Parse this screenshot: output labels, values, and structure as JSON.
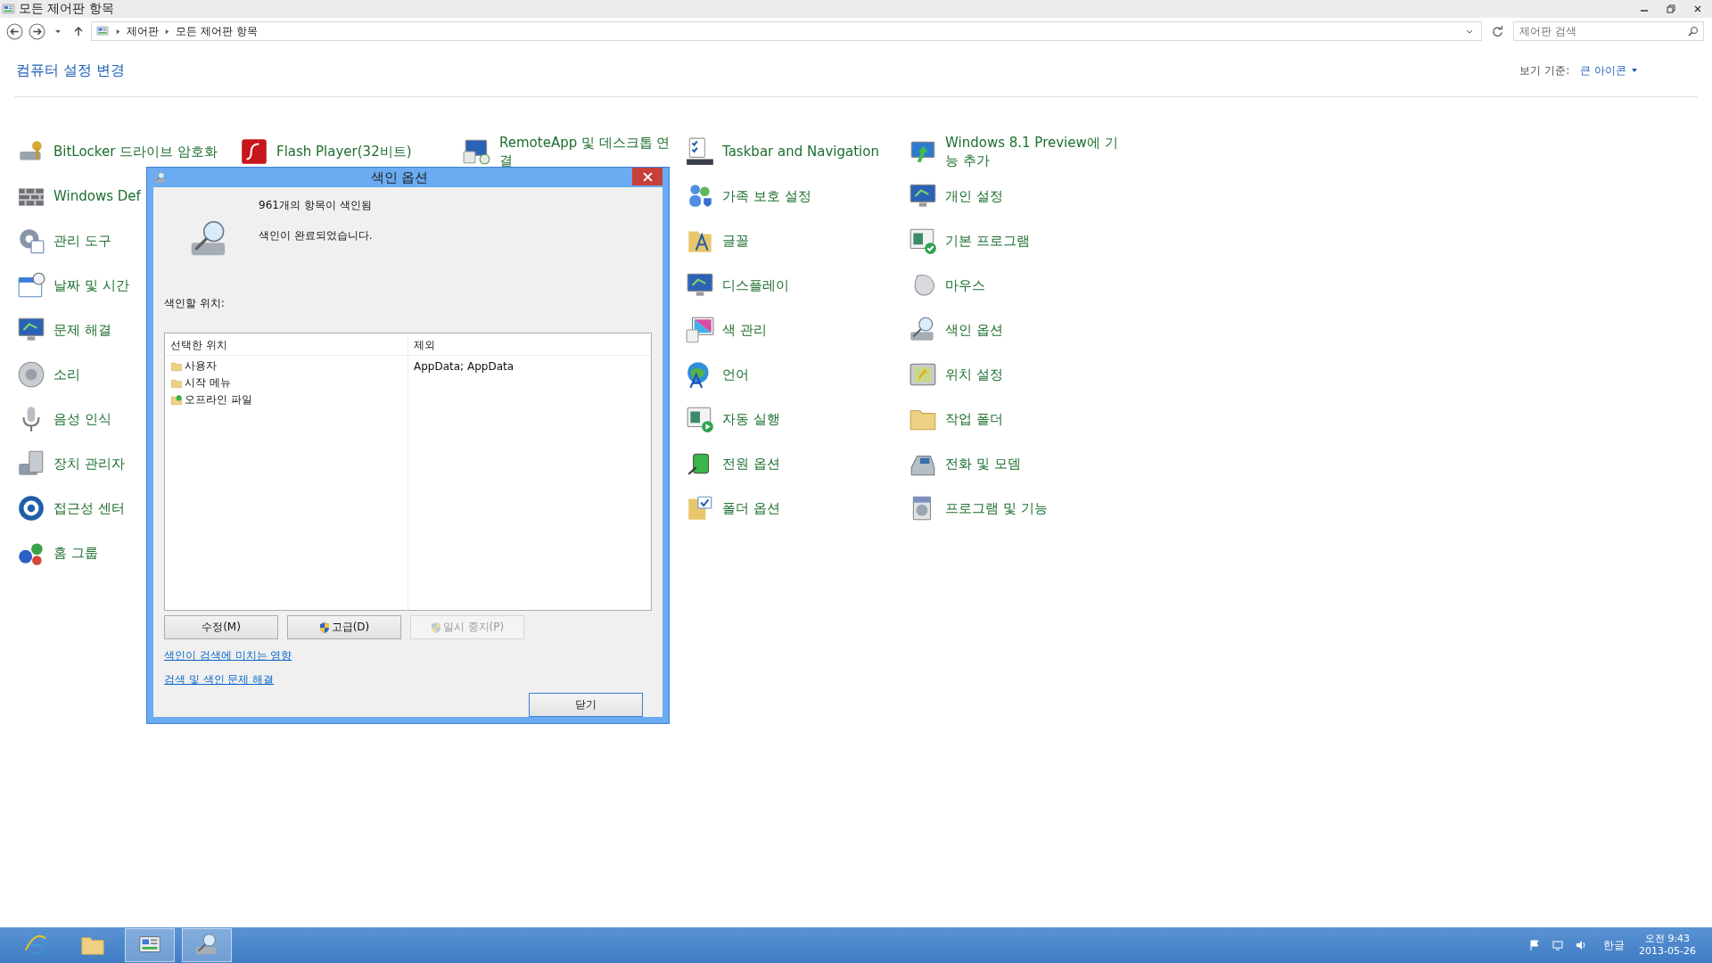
{
  "window": {
    "title": "모든 제어판 항목"
  },
  "address_bar": {
    "breadcrumbs": [
      "제어판",
      "모든 제어판 항목"
    ]
  },
  "search": {
    "placeholder": "제어판 검색"
  },
  "header": {
    "title": "컴퓨터 설정 변경",
    "view_label": "보기 기준:",
    "view_value": "큰 아이콘"
  },
  "columns": [
    {
      "items": [
        "BitLocker 드라이브 암호화",
        "Windows Def",
        "관리 도구",
        "날짜 및 시간",
        "문제 해결",
        "소리",
        "음성 인식",
        "장치 관리자",
        "접근성 센터",
        "홈 그룹"
      ]
    },
    {
      "items": [
        "Flash Player(32비트)"
      ]
    },
    {
      "items": [
        "RemoteApp 및 데스크톱 연결"
      ]
    },
    {
      "items": [
        "Taskbar and Navigation",
        "가족 보호 설정",
        "글꼴",
        "디스플레이",
        "색 관리",
        "언어",
        "자동 실행",
        "전원 옵션",
        "폴더 옵션"
      ]
    },
    {
      "items": [
        "Windows 8.1 Preview에 기능 추가",
        "개인 설정",
        "기본 프로그램",
        "마우스",
        "색인 옵션",
        "위치 설정",
        "작업 폴더",
        "전화 및 모뎀",
        "프로그램 및 기능"
      ]
    }
  ],
  "dialog": {
    "title": "색인 옵션",
    "status_count": "961개의 항목이 색인됨",
    "status_message": "색인이 완료되었습니다.",
    "locations_label": "색인할 위치:",
    "table": {
      "columns": [
        "선택한 위치",
        "제외"
      ],
      "rows": [
        {
          "location": "사용자",
          "exclude": "AppData; AppData",
          "kind": "folder"
        },
        {
          "location": "시작 메뉴",
          "kind": "folder"
        },
        {
          "location": "오프라인 파일",
          "kind": "sync"
        }
      ]
    },
    "buttons": [
      {
        "label": "수정(M)",
        "shield": false,
        "disabled": false
      },
      {
        "label": "고급(D)",
        "shield": true,
        "disabled": false
      },
      {
        "label": "일시 중지(P)",
        "shield": true,
        "disabled": true
      }
    ],
    "links": [
      "색인이 검색에 미치는 영향",
      "검색 및 색인 문제 해결"
    ],
    "close_button": "닫기"
  },
  "taskbar": {
    "apps": [
      {
        "selected": false
      },
      {
        "selected": false
      },
      {
        "selected": true
      },
      {
        "selected": true
      }
    ],
    "ime": "한글",
    "time": "오전 9:43",
    "date": "2013-05-26"
  }
}
